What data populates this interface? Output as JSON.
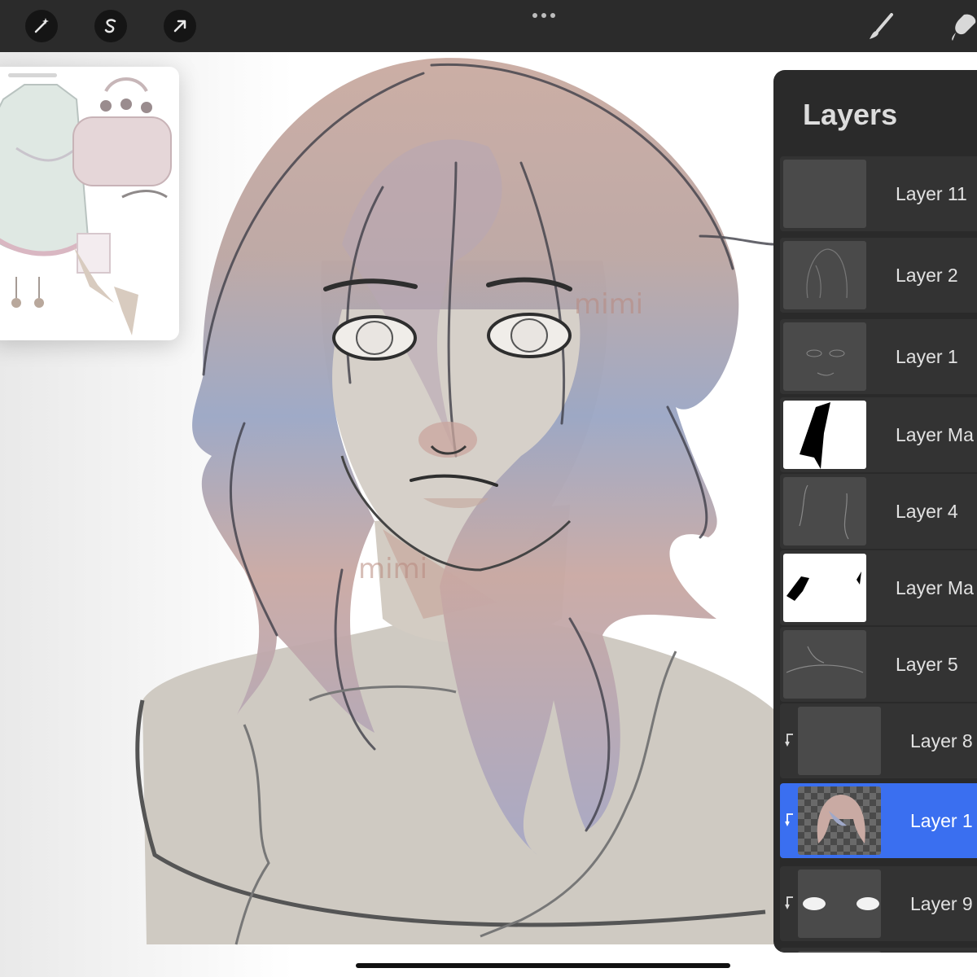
{
  "toolbar": {
    "left_tools": [
      "magic-wand",
      "selection",
      "transform"
    ],
    "menu_icon": "more-dots",
    "right_tools": [
      "brush",
      "smudge"
    ]
  },
  "canvas": {
    "watermarks": [
      "mimi",
      "mimi"
    ]
  },
  "layers_panel": {
    "title": "Layers",
    "items": [
      {
        "name": "Layer 11",
        "selected": false,
        "clipped": false,
        "thumb": "dark"
      },
      {
        "name": "Layer 2",
        "selected": false,
        "clipped": false,
        "thumb": "dark"
      },
      {
        "name": "Layer 1",
        "selected": false,
        "clipped": false,
        "thumb": "dark"
      },
      {
        "name": "Layer Ma",
        "selected": false,
        "clipped": false,
        "thumb": "white"
      },
      {
        "name": "Layer 4",
        "selected": false,
        "clipped": false,
        "thumb": "dark"
      },
      {
        "name": "Layer Ma",
        "selected": false,
        "clipped": false,
        "thumb": "white"
      },
      {
        "name": "Layer 5",
        "selected": false,
        "clipped": false,
        "thumb": "dark"
      },
      {
        "name": "Layer 8",
        "selected": false,
        "clipped": true,
        "thumb": "dark"
      },
      {
        "name": "Layer 1",
        "selected": true,
        "clipped": true,
        "thumb": "checker"
      },
      {
        "name": "Layer 9",
        "selected": false,
        "clipped": true,
        "thumb": "dark"
      }
    ]
  },
  "colors": {
    "selection": "#3a6ff0",
    "panel": "#2a2a2a",
    "toolbar": "#2b2b2b"
  }
}
